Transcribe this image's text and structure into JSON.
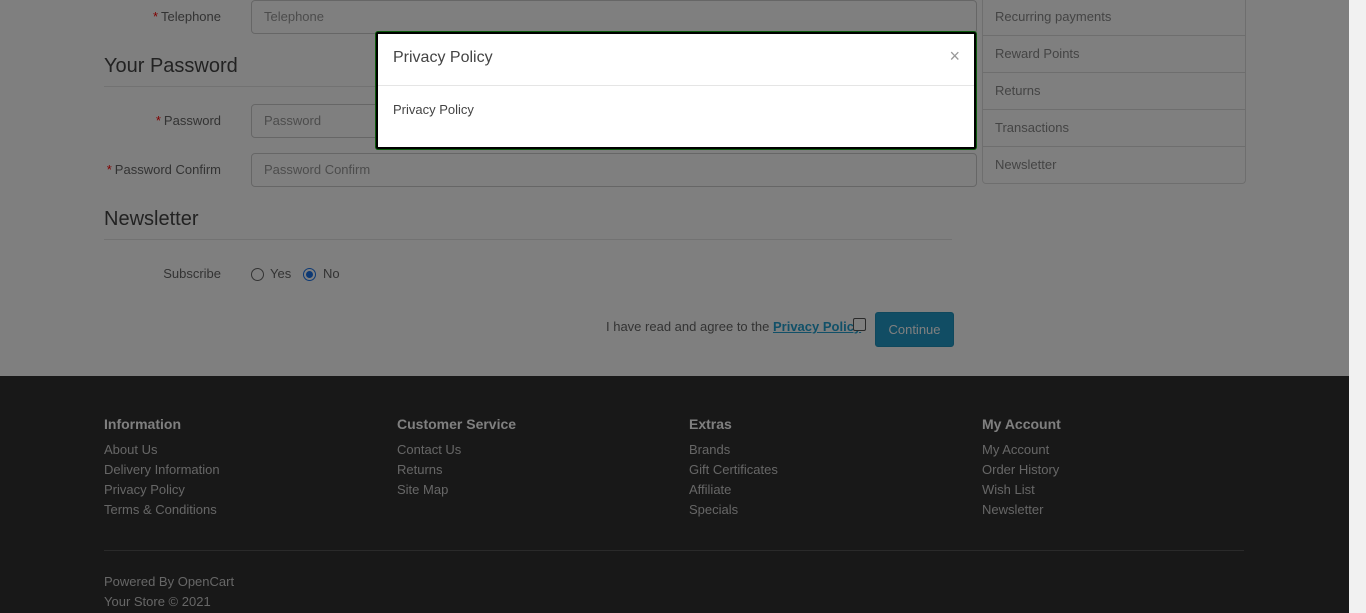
{
  "form": {
    "telephone": {
      "label": "Telephone",
      "placeholder": "Telephone"
    },
    "password_section": "Your Password",
    "password": {
      "label": "Password",
      "placeholder": "Password"
    },
    "password_confirm": {
      "label": "Password Confirm",
      "placeholder": "Password Confirm"
    },
    "newsletter_section": "Newsletter",
    "subscribe_label": "Subscribe",
    "subscribe_yes": "Yes",
    "subscribe_no": "No",
    "subscribe_selected": "No",
    "agree_text": "I have read and agree to the",
    "agree_link": "Privacy Policy",
    "continue_label": "Continue"
  },
  "sidebar": {
    "items": [
      {
        "label": "Recurring payments"
      },
      {
        "label": "Reward Points"
      },
      {
        "label": "Returns"
      },
      {
        "label": "Transactions"
      },
      {
        "label": "Newsletter"
      }
    ]
  },
  "footer": {
    "information": {
      "title": "Information",
      "links": [
        "About Us",
        "Delivery Information",
        "Privacy Policy",
        "Terms & Conditions"
      ]
    },
    "customer_service": {
      "title": "Customer Service",
      "links": [
        "Contact Us",
        "Returns",
        "Site Map"
      ]
    },
    "extras": {
      "title": "Extras",
      "links": [
        "Brands",
        "Gift Certificates",
        "Affiliate",
        "Specials"
      ]
    },
    "my_account": {
      "title": "My Account",
      "links": [
        "My Account",
        "Order History",
        "Wish List",
        "Newsletter"
      ]
    },
    "powered_prefix": "Powered By",
    "powered_brand": "OpenCart",
    "copyright": "Your Store © 2021"
  },
  "modal": {
    "title": "Privacy Policy",
    "body": "Privacy Policy",
    "close_glyph": "×"
  },
  "colors": {
    "accent": "#229ac8",
    "footer_bg": "#303030",
    "required": "#ff0000"
  }
}
